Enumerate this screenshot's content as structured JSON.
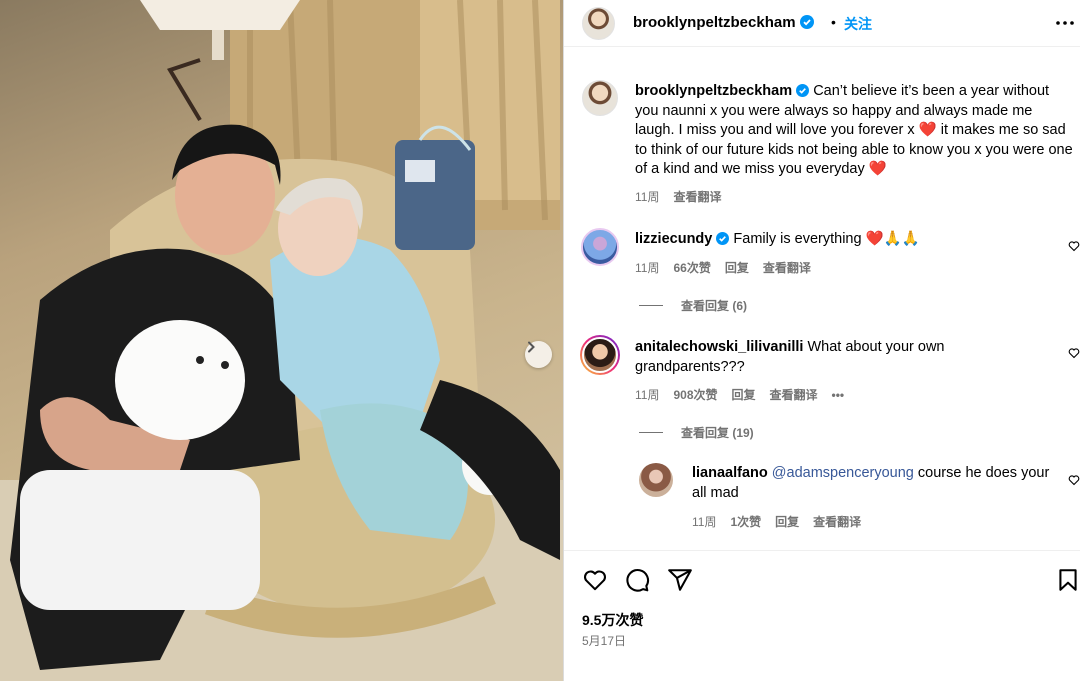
{
  "post": {
    "author": "brooklynpeltzbeckham",
    "follow_label": "关注",
    "dot": "•",
    "caption": "Can’t believe it’s been a year without you naunni x you were always so happy and always made me laugh. I miss you and will love you forever x ❤️ it makes me so sad to think of our future kids not being able to know you x you were one of a kind and we miss you everyday ❤️",
    "caption_time": "11周",
    "caption_translate": "查看翻译",
    "likes": "9.5万次赞",
    "date": "5月17日"
  },
  "comments": [
    {
      "user": "lizziecundy",
      "verified": true,
      "text": "Family is everything ❤️🙏🙏",
      "time": "11周",
      "likes": "66次赞",
      "reply": "回复",
      "translate": "查看翻译",
      "view_replies": "查看回复 (6)"
    },
    {
      "user": "anitalechowski_lilivanilli",
      "verified": false,
      "text": "What about your own grandparents???",
      "time": "11周",
      "likes": "908次赞",
      "reply": "回复",
      "translate": "查看翻译",
      "more": "•••",
      "view_replies": "查看回复 (19)"
    },
    {
      "user": "lianaalfano",
      "verified": false,
      "mention": "@adamspenceryoung",
      "text": " course he does your all mad",
      "time": "11周",
      "likes": "1次赞",
      "reply": "回复",
      "translate": "查看翻译"
    }
  ],
  "icons": {
    "verified": "verified-badge-icon",
    "like": "heart-icon",
    "comment": "comment-icon",
    "share": "share-icon",
    "save": "bookmark-icon",
    "next": "chevron-right-icon",
    "more": "more-options-icon"
  },
  "colors": {
    "accent": "#0095f6",
    "muted": "#737373",
    "verified": "#0095f6"
  }
}
